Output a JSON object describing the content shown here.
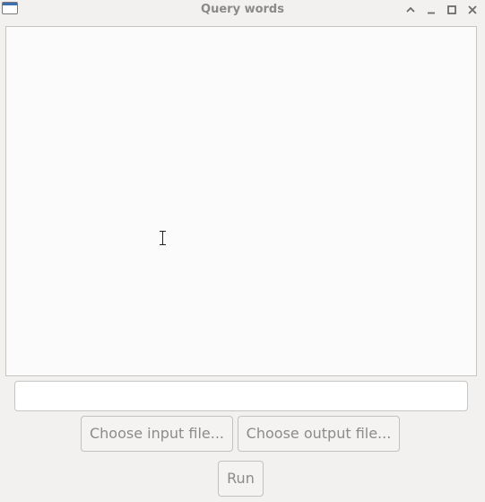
{
  "window": {
    "title": "Query words",
    "icons": {
      "app": "window-app-icon",
      "shade": "chevron-up-icon",
      "minimize": "minimize-icon",
      "maximize": "maximize-icon",
      "close": "close-icon"
    }
  },
  "main": {
    "output_text": "",
    "query_value": "",
    "buttons": {
      "choose_input": "Choose input file...",
      "choose_output": "Choose output file...",
      "run": "Run"
    }
  },
  "colors": {
    "background": "#f2f1f0",
    "text_area": "#fbfbfb",
    "title_text": "#8a8a8a",
    "button_text": "#8b8b8b"
  }
}
